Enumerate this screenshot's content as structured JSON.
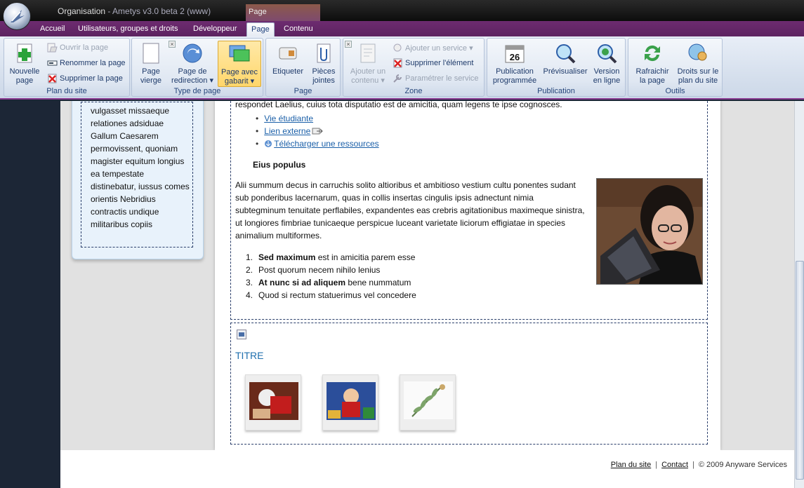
{
  "window": {
    "title": "Organisation",
    "title_suffix": " - Ametys v3.0 beta 2 (www)",
    "context_tab": "Page"
  },
  "tabs": [
    {
      "label": "Accueil",
      "active": false
    },
    {
      "label": "Utilisateurs, groupes et droits",
      "active": false
    },
    {
      "label": "Développeur",
      "active": false
    },
    {
      "label": "Page",
      "active": true
    },
    {
      "label": "Contenu",
      "active": false
    }
  ],
  "ribbon": {
    "plan": {
      "label": "Plan du site",
      "nouvelle_page": "Nouvelle\npage",
      "ouvrir": "Ouvrir la page",
      "renommer": "Renommer la page",
      "supprimer": "Supprimer la page"
    },
    "type": {
      "label": "Type de page",
      "vierge": "Page\nvierge",
      "redirection": "Page de\nredirection ▾",
      "gabarit": "Page avec\ngabarit ▾"
    },
    "page": {
      "label": "Page",
      "etiqueter": "Etiqueter",
      "pieces": "Pièces\njointes"
    },
    "zone": {
      "label": "Zone",
      "ajouter_contenu": "Ajouter un\ncontenu ▾",
      "ajouter_service": "Ajouter un service ▾",
      "supprimer_element": "Supprimer l'élément",
      "parametrer": "Paramétrer le service"
    },
    "publication": {
      "label": "Publication",
      "programmee": "Publication\nprogrammée",
      "calendar_day": "26",
      "previsualiser": "Prévisualiser",
      "version": "Version\nen ligne"
    },
    "outils": {
      "label": "Outils",
      "rafraichir": "Rafraichir\nla page",
      "droits": "Droits sur le\nplan du site"
    }
  },
  "sidebar_text": "vulgasset missaeque relationes adsiduae Gallum Caesarem permovissent, quoniam magister equitum longius ea tempestate distinebatur, iussus comes orientis Nebridius contractis undique militaribus copiis",
  "content": {
    "top_line": "respondet Laelius, cuius tota disputatio est de amicitia, quam legens te ipse cognosces.",
    "links": [
      "Vie étudiante",
      "Lien externe",
      "Télécharger une ressources"
    ],
    "heading": "Eius populus",
    "paragraph": "Alii summum decus in carruchis solito altioribus et ambitioso vestium cultu ponentes sudant sub ponderibus lacernarum, quas in collis insertas cingulis ipsis adnectunt nimia subtegminum tenuitate perflabiles, expandentes eas crebris agitationibus maximeque sinistra, ut longiores fimbriae tunicaeque perspicue luceant varietate liciorum effigiatae in species animalium multiformes.",
    "list": [
      {
        "num": "1.",
        "bold": "Sed maximum",
        "rest": " est in amicitia parem esse"
      },
      {
        "num": "2.",
        "bold": "",
        "rest": "Post quorum necem nihilo lenius"
      },
      {
        "num": "3.",
        "bold": "At nunc si ad aliquem",
        "rest": " bene nummatum"
      },
      {
        "num": "4.",
        "bold": "",
        "rest": "Quod si rectum statuerimus vel concedere"
      }
    ],
    "gallery_title": "TITRE"
  },
  "footer": {
    "plan": "Plan du site",
    "contact": "Contact",
    "copyright": "© 2009 Anyware Services"
  },
  "colors": {
    "accent": "#6d2b70",
    "ribbon": "#dfe7f2",
    "link": "#1a5fa8",
    "title_blue": "#1f6fae"
  }
}
